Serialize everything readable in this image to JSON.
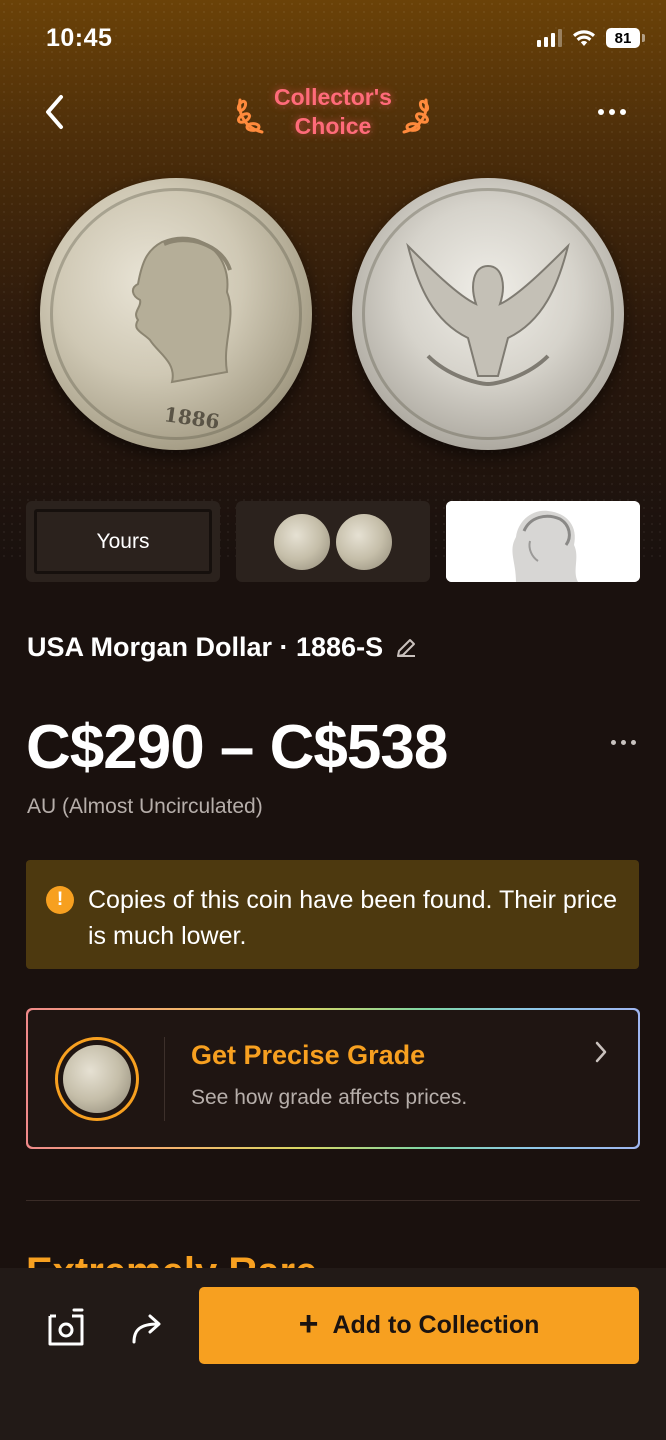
{
  "status_bar": {
    "time": "10:45",
    "battery": "81"
  },
  "header": {
    "badge_text": "Collector's\nChoice",
    "back_icon": "chevron-left-icon",
    "more_icon": "more-horizontal-icon"
  },
  "coin_images": {
    "front_date": "1886"
  },
  "thumbnails": {
    "yours_label": "Yours"
  },
  "coin": {
    "title": "USA Morgan Dollar · 1886-S",
    "price_range": "C$290 – C$538",
    "grade": "AU (Almost Uncirculated)"
  },
  "warning": {
    "text": "Copies of this coin have been found. Their price is much lower."
  },
  "grade_card": {
    "title": "Get Precise Grade",
    "subtitle": "See how grade affects prices."
  },
  "next_section": {
    "title": "Extremely Rare"
  },
  "bottom_bar": {
    "add_label": "Add to Collection",
    "plus": "+"
  },
  "colors": {
    "accent": "#f7a020",
    "badge": "#ff6b7a",
    "warning_bg": "#4d390f"
  }
}
